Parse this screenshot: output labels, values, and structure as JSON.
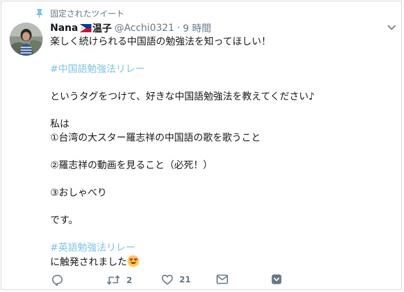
{
  "pinned_label": "固定されたツイート",
  "tweet": {
    "display_name": "Nana",
    "display_name_suffix": "温子",
    "handle": "@Acchi0321",
    "separator": "·",
    "timestamp": "9 時間",
    "lines": [
      {
        "text": "楽しく続けられる中国語の勉強法を知ってほしい！",
        "type": "text"
      },
      {
        "text": "",
        "type": "gap"
      },
      {
        "text": "#中国語勉強法リレー",
        "type": "hashtag"
      },
      {
        "text": "",
        "type": "gap"
      },
      {
        "text": "というタグをつけて、好きな中国語勉強法を教えてください♪",
        "type": "text"
      },
      {
        "text": "",
        "type": "gap"
      },
      {
        "text": "私は",
        "type": "text"
      },
      {
        "text": "①台湾の大スター羅志祥の中国語の歌を歌うこと",
        "type": "text"
      },
      {
        "text": "",
        "type": "gap"
      },
      {
        "text": "②羅志祥の動画を見ること（必死！）",
        "type": "text"
      },
      {
        "text": "",
        "type": "gap"
      },
      {
        "text": "③おしゃべり",
        "type": "text"
      },
      {
        "text": "",
        "type": "gap"
      },
      {
        "text": "です。",
        "type": "text"
      },
      {
        "text": "",
        "type": "gap"
      },
      {
        "text": "#英語勉強法リレー",
        "type": "hashtag"
      },
      {
        "text": "に触発されました",
        "type": "text_emoji"
      }
    ]
  },
  "actions": {
    "reply": {
      "icon": "reply-icon",
      "count": ""
    },
    "retweet": {
      "icon": "retweet-icon",
      "count": "2"
    },
    "like": {
      "icon": "heart-icon",
      "count": "21"
    },
    "dm": {
      "icon": "envelope-icon",
      "count": ""
    },
    "more": {
      "icon": "chevron-badge-icon",
      "count": ""
    }
  },
  "colors": {
    "hashtag": "#7ec4e3",
    "muted": "#657786",
    "text": "#14171a",
    "pin": "#7ec4e3"
  }
}
